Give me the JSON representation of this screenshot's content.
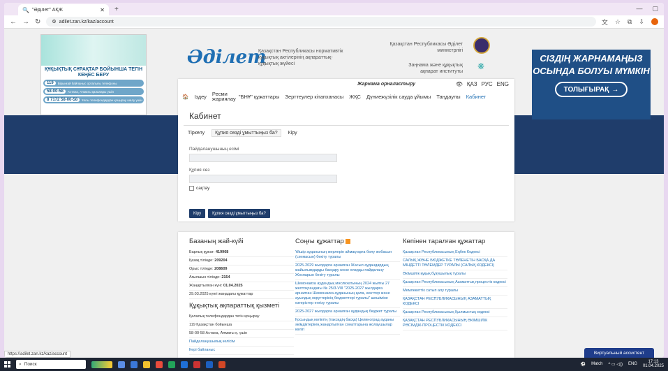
{
  "browser": {
    "tab_title": "\"Әділет\" АҚЖ",
    "url": "adilet.zan.kz/kaz/account"
  },
  "left_ad": {
    "title": "ҚҰҚЫҚТЫҚ СҰРАҚТАР БОЙЫНША ТЕГІН КЕҢЕС БЕРУ",
    "rows": [
      {
        "num": "119",
        "text": "Бірыңғай байланыс орталығы телефоны"
      },
      {
        "num": "58-00-58",
        "text": "Астана, Алматы қалалары үшін"
      },
      {
        "num": "8 7172 58-00-58",
        "text": "Ұялы телефондардан қоңырау шалу үшін"
      }
    ]
  },
  "right_ad": {
    "text": "СІЗДІҢ ЖАРНАМАҢЫЗ ОСЫНДА БОЛУЫ МҮМКІН",
    "button": "ТОЛЫҒЫРАҚ",
    "arrow": "→"
  },
  "header": {
    "logo": "Әділет",
    "logo_text": "Қазақстан Республикасы нормативтік құқықтық актілерінің ақпараттық-құқықтық жүйесі",
    "ministry": "Қазақстан Республикасы Әділет министрлігі",
    "institute": "Заңнама және құқықтық ақпарат институты"
  },
  "advert_label": "Жарнама орналастыру",
  "langs": [
    "ҚАЗ",
    "РУС",
    "ENG"
  ],
  "menu": [
    "Іздеу",
    "Ресми жариялау",
    "\"БНҰ\" құжаттары",
    "Зерттеулер кітапханасы",
    "ЖҚС",
    "Дүниежүзілік сауда ұйымы",
    "Таңдаулы",
    "Кабинет"
  ],
  "cabinet": {
    "title": "Кабинет",
    "tabs": [
      "Тіркелу",
      "Құпия сөзді ұмыттыңыз ба?",
      "Кіру"
    ],
    "username_label": "Пайдаланушының есімі",
    "password_label": "Құпия сөз",
    "remember": "сақтау",
    "login_btn": "Кіру",
    "forgot_btn": "Құпия сөзді ұмыттыңыз ба?"
  },
  "db_state": {
    "title": "Базаның жай-күйі",
    "lines": [
      {
        "k": "Барлық құжат:",
        "v": "419968"
      },
      {
        "k": "Қазақ тілінде:",
        "v": "209204"
      },
      {
        "k": "Орыс тілінде:",
        "v": "208609"
      },
      {
        "k": "Ағылшын тілінде:",
        "v": "2154"
      },
      {
        "k": "Жаңартылған күні:",
        "v": "01.04.2025"
      }
    ],
    "new_docs": "29.03.2025 күнгі жаңадағы құжаттар",
    "service_title": "Құқықтық ақпараттық қызметі",
    "service_lines": [
      "Қалалық телефондардан тегін қоңырау",
      "119 Қазақстан бойынша",
      "58-00-58 Астана, Алматы қ. үшін",
      "Пайдаланушылық келісім",
      "Кері байланыс"
    ]
  },
  "latest": {
    "title": "Соңғы құжаттар",
    "items": [
      "Үйшір ауданының жерлерін аймақтарға бөлу жобасын (схемасын) бекіту туралы",
      "2025-2029 жылдарға арналған Жасыл аудандардың жайылымдарды басқару және оларды пайдалану Жоспарын бекіту туралы",
      "Шемонаиха аудандық мәслихатының 2024 жылғы 27 желтоқсандағы № 25/3-VIII \"2025-2027 жылдарға арналған Шемонаиха ауданының қала, кенттер және ауылдық округтерінің бюджеттері туралы\" шешіміне өзгерістер енгізу туралы",
      "2025-2027 жылдарға арналған аудандық бюджет туралы",
      "Қосындық көліктің (таксидің басқа) Целиноград ауданы әкімдіктерінің жаңартылған сонаттарына жолаушылар көлігі"
    ]
  },
  "popular": {
    "title": "Көпінен таралған құжаттар",
    "items": [
      "Қазақстан Республикасының Еңбек Кодексі",
      "САЛЫҚ ЖӘНЕ БЮДЖЕТКЕ ТӨЛЕНЕТІН БАСҚА ДА МІНДЕТТІ ТӨЛЕМДЕР ТУРАЛЫ (САЛЫҚ КОДЕКСІ)",
      "Әкімшілік құқық бұзушылық туралы",
      "Қазақстан Республикасының Азаматтық процестік кодексі",
      "Мемлекеттік сатып алу туралы",
      "ҚАЗАҚСТАН РЕСПУБЛИКАСЫНЫҢ АЗАМАТТЫҚ КОДЕКСІ",
      "Қазақстан Республикасының Қылмыстық кодексі",
      "ҚАЗАҚСТАН РЕСПУБЛИКАСЫНЫҢ ӘКІМШІЛІК РӘСІМДІК-ПРОЦЕСТІК КОДЕКСІ"
    ]
  },
  "status_url": "https://adilet.zan.kz/kaz/account",
  "assistant": "Виртуальный ассистент",
  "taskbar": {
    "search": "Поиск",
    "match": "Match",
    "lang": "ENG",
    "time": "17:13",
    "date": "01.04.2025"
  }
}
